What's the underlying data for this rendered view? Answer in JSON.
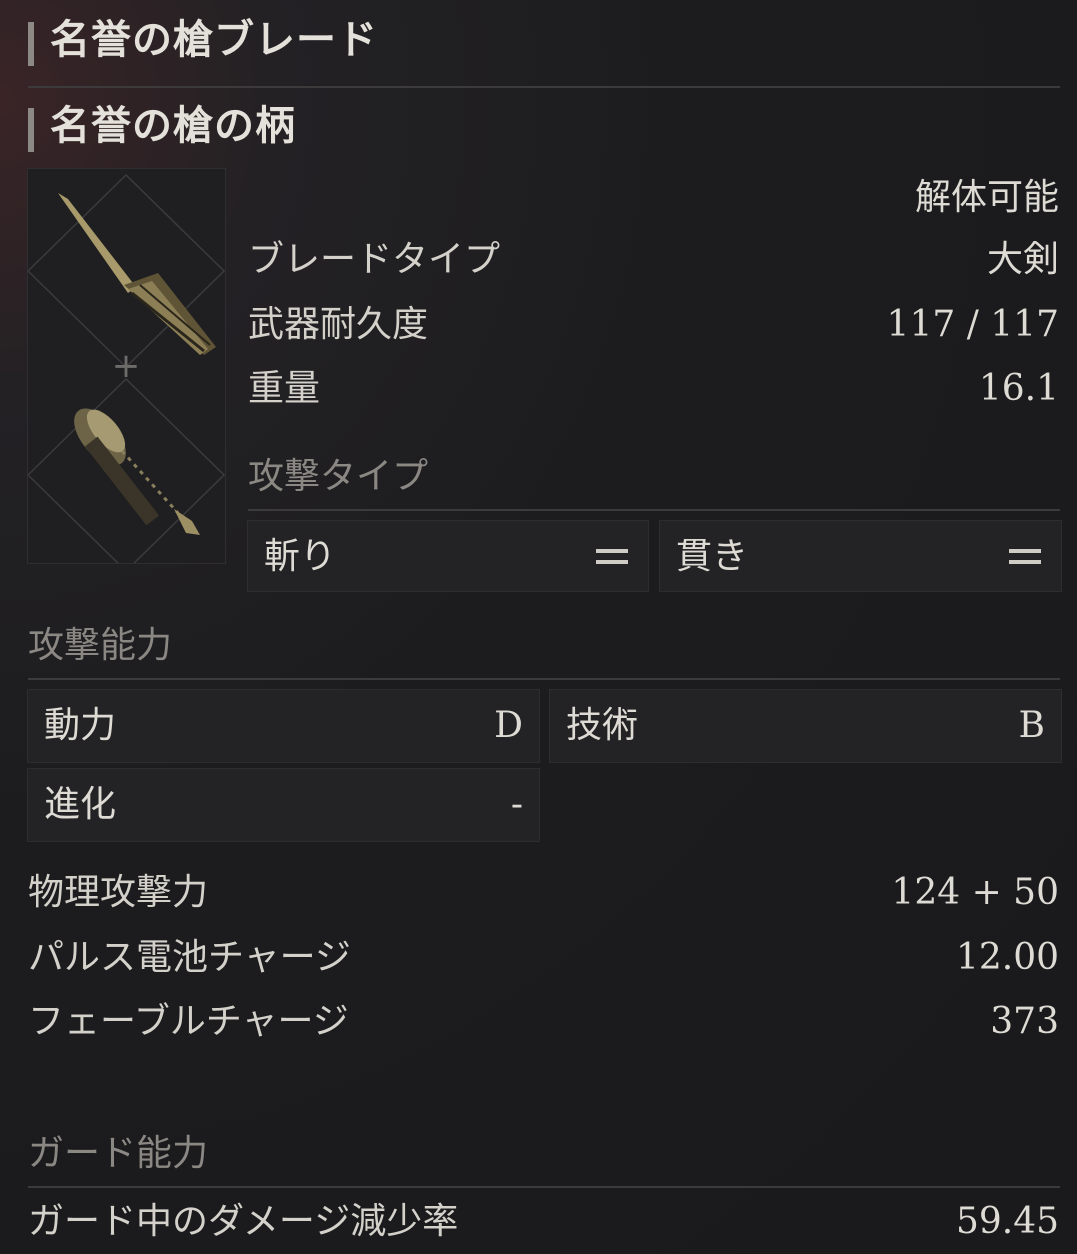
{
  "header": {
    "blade_name": "名誉の槍ブレード",
    "handle_name": "名誉の槍の柄"
  },
  "item": {
    "dismantle": "解体可能",
    "blade_type_label": "ブレードタイプ",
    "blade_type_value": "大剣",
    "durability_label": "武器耐久度",
    "durability_value": "117 / 117",
    "weight_label": "重量",
    "weight_value": "16.1",
    "connector_glyph": "+"
  },
  "attack_type": {
    "heading": "攻撃タイプ",
    "types": [
      {
        "label": "斬り",
        "icon": "equals-icon"
      },
      {
        "label": "貫き",
        "icon": "equals-icon"
      }
    ]
  },
  "attack_ability": {
    "heading": "攻撃能力",
    "scaling": [
      {
        "label": "動力",
        "grade": "D"
      },
      {
        "label": "技術",
        "grade": "B"
      },
      {
        "label": "進化",
        "grade": "-"
      }
    ]
  },
  "stats": [
    {
      "label": "物理攻撃力",
      "value": "124 + 50"
    },
    {
      "label": "パルス電池チャージ",
      "value": "12.00"
    },
    {
      "label": "フェーブルチャージ",
      "value": "373"
    }
  ],
  "guard": {
    "heading": "ガード能力",
    "damage_reduction_label": "ガード中のダメージ減少率",
    "damage_reduction_value": "59.45"
  },
  "colors": {
    "background": "#1b1b1d",
    "text": "#dedbd5",
    "muted": "#8b8884",
    "accent_bar": "#8d8a86"
  }
}
